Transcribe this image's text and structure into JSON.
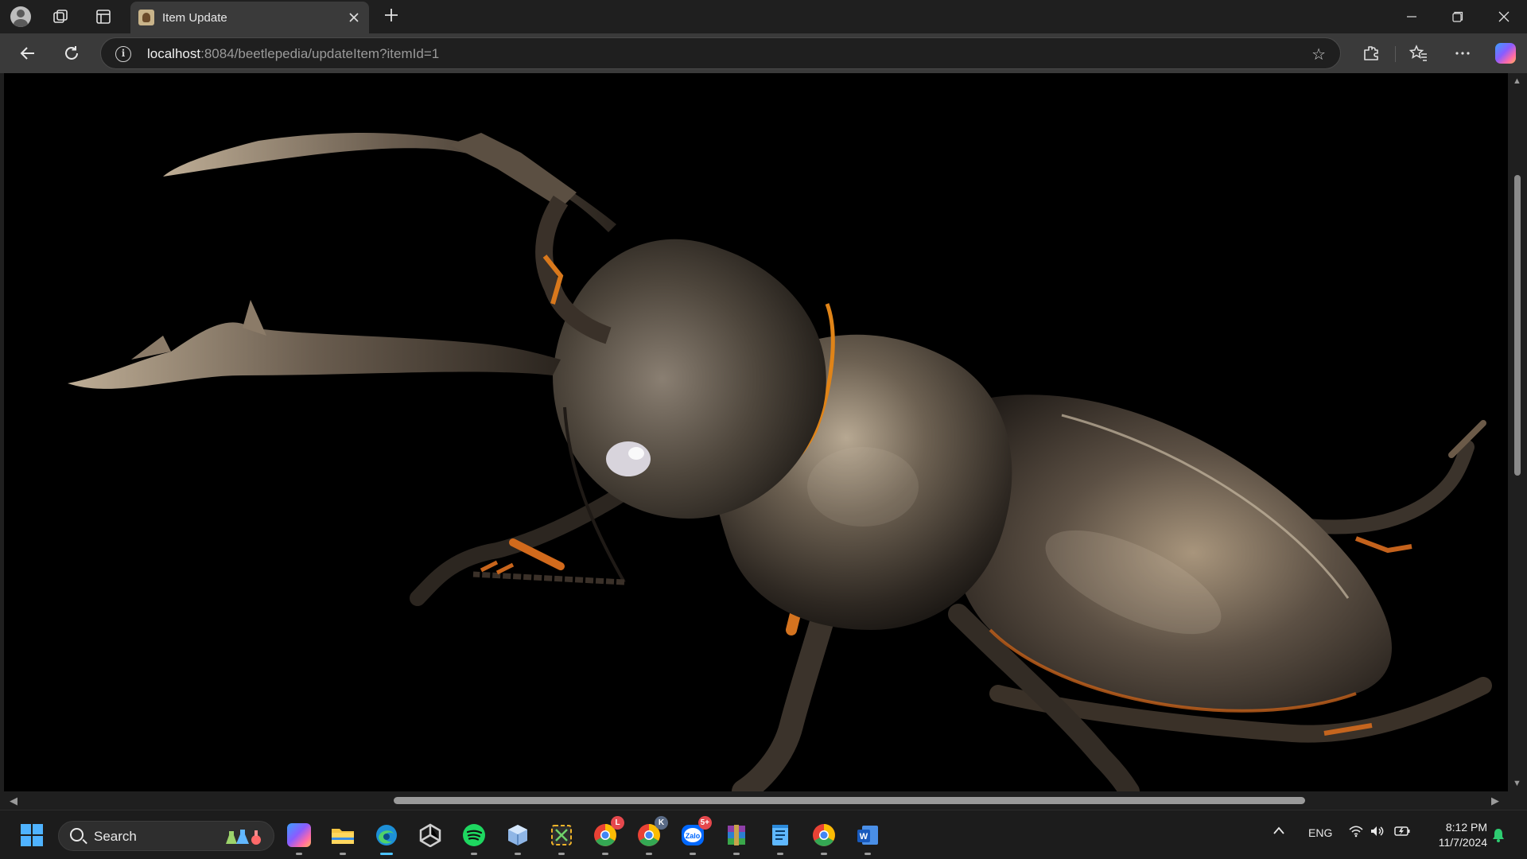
{
  "browser": {
    "tab": {
      "title": "Item Update"
    },
    "address_bar": {
      "host": "localhost",
      "rest": ":8084/beetlepedia/updateItem?itemId=1"
    }
  },
  "page": {
    "content": "stag-beetle-photo",
    "colors": {
      "background": "#000000",
      "beetle_shell": "#4a4035",
      "accent_orange": "#e0801a"
    }
  },
  "taskbar": {
    "search_label": "Search",
    "language": "ENG",
    "time": "8:12 PM",
    "date": "11/7/2024",
    "badges": {
      "chrome_l": "L",
      "chrome_k": "K",
      "zalo": "5+"
    },
    "apps": [
      "start",
      "search",
      "copilot",
      "file-explorer",
      "edge",
      "unity",
      "spotify",
      "virtualbox",
      "snipping-tool",
      "chrome-l",
      "chrome-k",
      "zalo",
      "winrar",
      "notepad",
      "chrome",
      "word"
    ]
  }
}
